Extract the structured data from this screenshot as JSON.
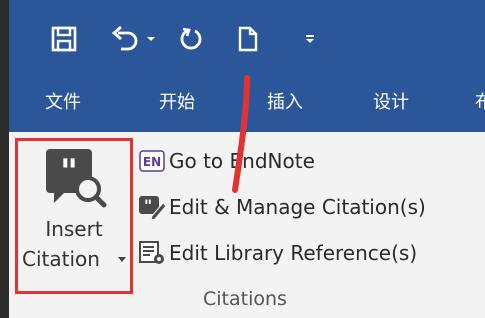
{
  "quick_access": {
    "icons": [
      "save-icon",
      "undo-icon",
      "undo-dropdown-icon",
      "redo-icon",
      "new-document-icon",
      "customize-toolbar-icon"
    ]
  },
  "tabs": [
    {
      "label": "文件"
    },
    {
      "label": "开始"
    },
    {
      "label": "插入"
    },
    {
      "label": "设计"
    },
    {
      "label": "布"
    }
  ],
  "ribbon_group": {
    "label": "Citations",
    "insert_citation": {
      "line1": "Insert",
      "line2": "Citation"
    },
    "commands": [
      {
        "label": "Go to EndNote",
        "icon": "endnote-icon",
        "icon_text": "EN"
      },
      {
        "label": "Edit & Manage Citation(s)",
        "icon": "edit-citation-icon"
      },
      {
        "label": "Edit Library Reference(s)",
        "icon": "edit-library-reference-icon"
      }
    ]
  },
  "colors": {
    "ribbon_blue": "#2b579a",
    "ribbon_body": "#f3f3f3",
    "highlight_red": "#e23232",
    "endnote_purple": "#5b3c9a"
  }
}
